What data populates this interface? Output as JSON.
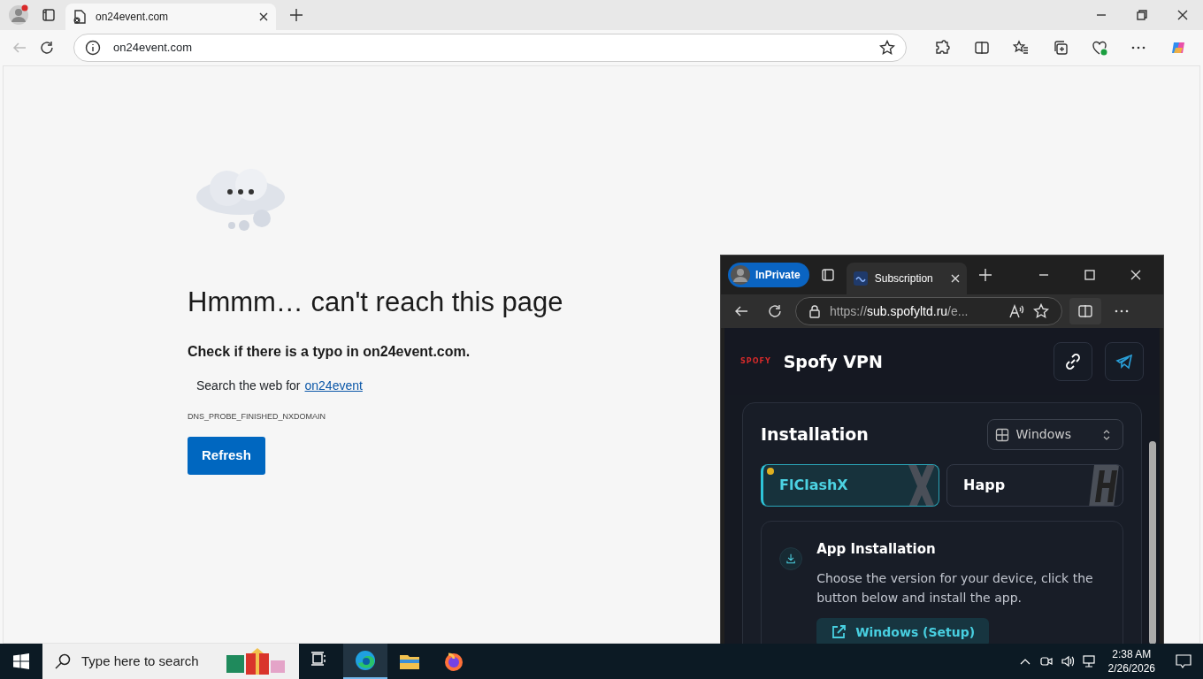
{
  "browser": {
    "tabs": [
      {
        "title": "on24event.com",
        "selected": true
      }
    ],
    "address": "on24event.com"
  },
  "error_page": {
    "heading": "Hmmm… can't reach this page",
    "typo_line": "Check if there is a typo in on24event.com.",
    "search_prefix": "Search the web for",
    "search_link": "on24event",
    "error_code": "DNS_PROBE_FINISHED_NXDOMAIN",
    "button": "Refresh"
  },
  "private_window": {
    "badge": "InPrivate",
    "tabs": [
      {
        "title": "Subscription",
        "selected": true
      }
    ],
    "address": {
      "scheme": "https://",
      "host": "sub.spofyltd.ru",
      "rest": "/e..."
    },
    "logo_text": "SPOFY",
    "site_title": "Spofy VPN",
    "installation": {
      "title": "Installation",
      "platform": "Windows",
      "apps": [
        {
          "name": "FlClashX",
          "selected": true,
          "kind": "cross"
        },
        {
          "name": "Happ",
          "selected": false,
          "kind": "slashed"
        }
      ],
      "step_title": "App Installation",
      "step_text": "Choose the version for your device, click the button below and install the app.",
      "download_button": "Windows (Setup)"
    }
  },
  "taskbar": {
    "search_placeholder": "Type here to search",
    "time": "2:38 AM",
    "date": "2/26/2026",
    "apps": [
      {
        "kind": "taskview",
        "active": false
      },
      {
        "kind": "edge",
        "active": true
      },
      {
        "kind": "folder",
        "active": false
      },
      {
        "kind": "firefox",
        "active": false
      }
    ]
  }
}
